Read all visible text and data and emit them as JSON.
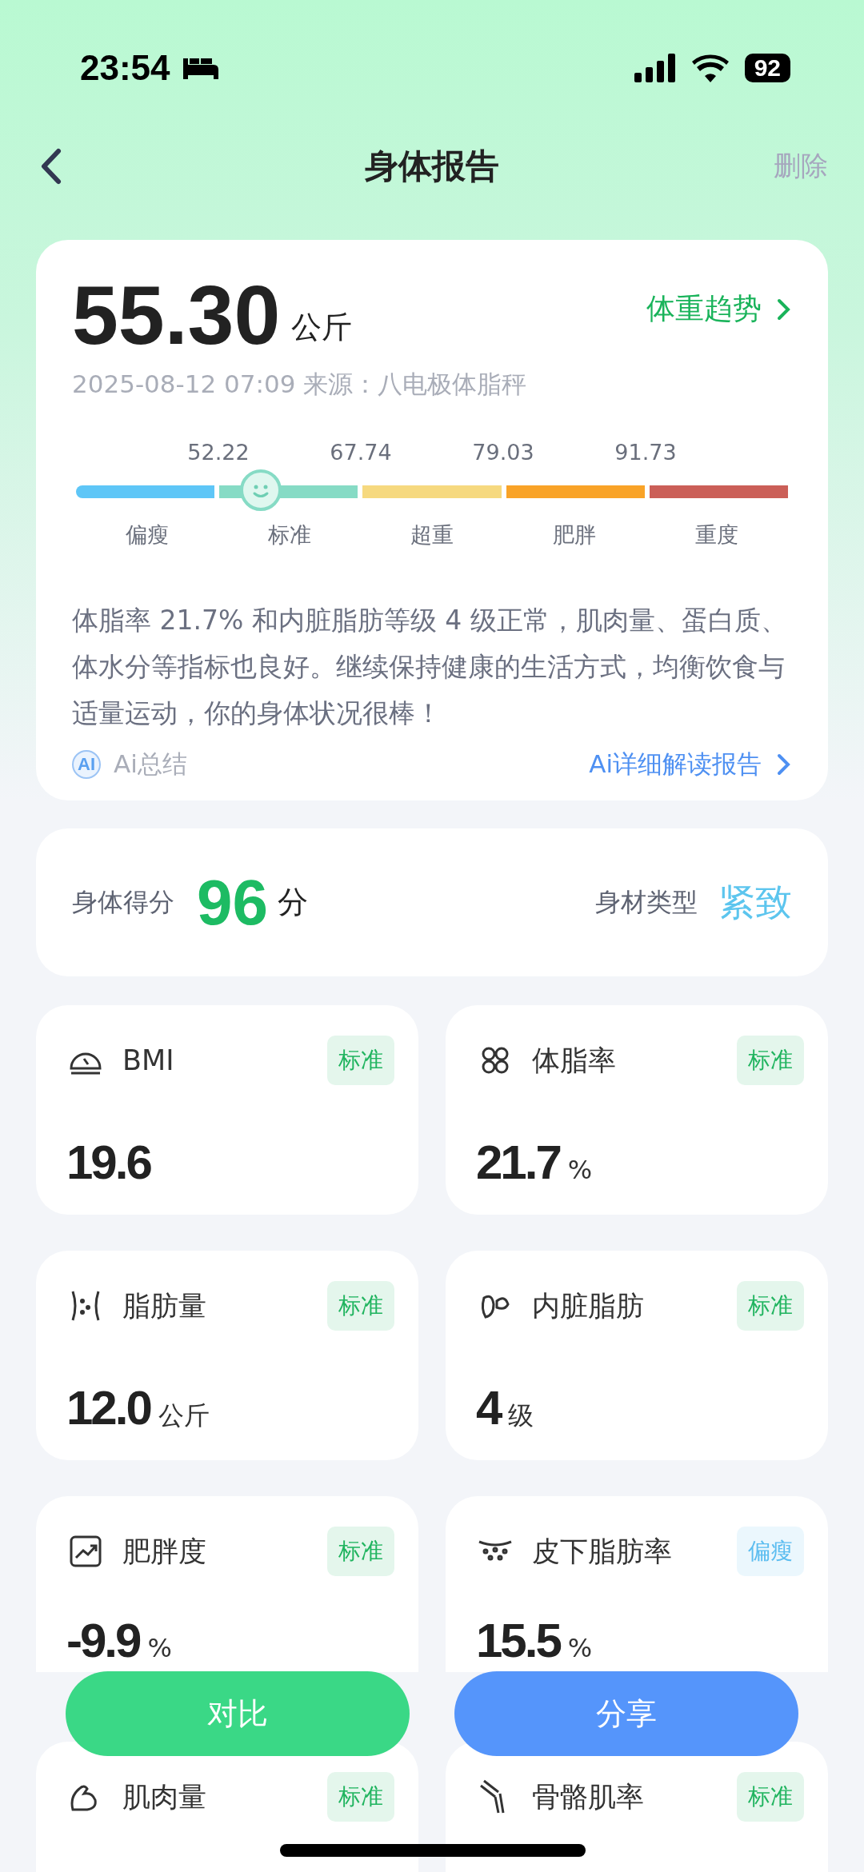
{
  "status_bar": {
    "time": "23:54",
    "battery": "92"
  },
  "header": {
    "title": "身体报告",
    "action": "删除"
  },
  "weight_card": {
    "value": "55.30",
    "unit": "公斤",
    "trend_link": "体重趋势",
    "meta": "2025-08-12 07:09 来源：八电极体脂秤",
    "scale": {
      "level": 0.26,
      "thresholds": [
        "52.22",
        "67.74",
        "79.03",
        "91.73"
      ],
      "segments": [
        {
          "label": "偏瘦",
          "color": "#5ec6f7"
        },
        {
          "label": "标准",
          "color": "#86dbc5"
        },
        {
          "label": "超重",
          "color": "#f6d97f"
        },
        {
          "label": "肥胖",
          "color": "#f9a327"
        },
        {
          "label": "重度",
          "color": "#cb5f58"
        }
      ]
    },
    "summary": "体脂率 21.7% 和内脏脂肪等级 4 级正常，肌肉量、蛋白质、体水分等指标也良好。继续保持健康的生活方式，均衡饮食与适量运动，你的身体状况很棒！",
    "ai_badge": "AI",
    "ai_label": "Ai总结",
    "ai_link": "Ai详细解读报告"
  },
  "score_card": {
    "label": "身体得分",
    "score": "96",
    "unit": "分",
    "type_label": "身材类型",
    "type_value": "紧致"
  },
  "metrics": [
    {
      "name": "BMI",
      "tag": "标准",
      "color": "#20b45f",
      "value": "19.6"
    },
    {
      "name": "体脂率",
      "tag": "标准",
      "color": "#20b45f",
      "value": "21.7",
      "unit": "%"
    },
    {
      "name": "脂肪量",
      "tag": "标准",
      "color": "#20b45f",
      "value": "12.0",
      "unit": "公斤"
    },
    {
      "name": "内脏脂肪",
      "tag": "标准",
      "color": "#20b45f",
      "value": "4",
      "unit": "级"
    },
    {
      "name": "肥胖度",
      "tag": "标准",
      "color": "#20b45f",
      "value": "-9.9",
      "unit": "%"
    },
    {
      "name": "皮下脂肪率",
      "tag": "偏瘦",
      "color": "#5cbdf0",
      "value": "15.5",
      "unit": "%"
    },
    {
      "name": "肌肉量",
      "tag": "标准",
      "color": "#20b45f"
    },
    {
      "name": "骨骼肌率",
      "tag": "标准",
      "color": "#20b45f"
    }
  ],
  "actions": [
    {
      "label": "对比",
      "color": "#3ad886"
    },
    {
      "label": "分享",
      "color": "#5595fb"
    }
  ]
}
